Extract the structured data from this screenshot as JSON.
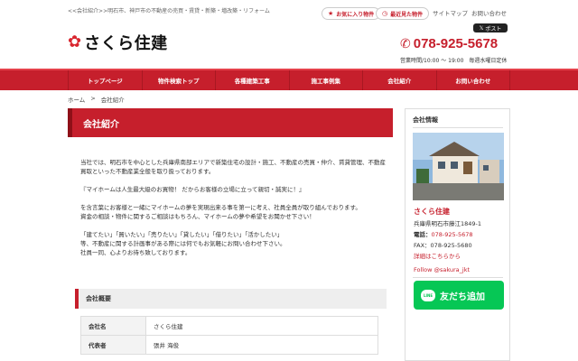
{
  "header": {
    "tagline": "<<会社紹介>>明石市、神戸市の不動産の売買・賃貸・新築・増改築・リフォーム",
    "favorites_label": "お気に入り物件",
    "recent_label": "最近見た物件",
    "sitemap_label": "サイトマップ",
    "contact_label": "お問い合わせ",
    "logo_text": "さくら住建",
    "x_post_label": "ポスト",
    "phone": "078-925-5678",
    "hours": "営業時間/10:00 ～ 19:00　毎週水曜日定休"
  },
  "nav": {
    "items": [
      {
        "label": "トップページ"
      },
      {
        "label": "物件検索トップ"
      },
      {
        "label": "各種建築工事"
      },
      {
        "label": "施工事例集"
      },
      {
        "label": "会社紹介"
      },
      {
        "label": "お問い合わせ"
      }
    ]
  },
  "breadcrumb": {
    "home": "ホーム",
    "sep": ">",
    "current": "会社紹介"
  },
  "main": {
    "title": "会社紹介",
    "paragraphs": [
      "当社では、明石市を中心とした兵庫県南部エリアで新築住宅の設計・施工、不動産の売買・仲介、賃貸管理、不動産買取といった不動産業全般を取り扱っております。",
      "『マイホームは人生最大級のお買物！ だからお客様の立場に立って親切・誠実に！』",
      "を含言葉にお客様と一緒にマイホームの夢を実現出来る事を第一に考え、社員全員が取り組んでおります。\n資金の相談・物件に関するご相談はもちろん、マイホームの夢や希望をお聞かせ下さい！",
      "「建てたい」「買いたい」「売りたい」「貸したい」「借りたい」「活かしたい」\n等、不動産に関する計画事がある際には何でもお気軽にお問い合わせ下さい。\n社員一同、心よりお待ち致しております。"
    ],
    "overview_title": "会社概要",
    "overview_rows": [
      {
        "label": "会社名",
        "value": "さくら住建"
      },
      {
        "label": "代表者",
        "value": "張井 海俊"
      }
    ]
  },
  "sidebar": {
    "title": "会社情報",
    "company_name": "さくら住建",
    "address": "兵庫県明石市藤江1849-1",
    "tel_label": "電話：",
    "tel": "078-925-5678",
    "fax": "FAX：078-925-5680",
    "details_link": "詳細はこちらから",
    "follow": "Follow @sakura_jkt",
    "line_icon_text": "LINE",
    "line_button": "友だち追加"
  },
  "colors": {
    "brand_red": "#c61f2c",
    "line_green": "#06c755"
  }
}
